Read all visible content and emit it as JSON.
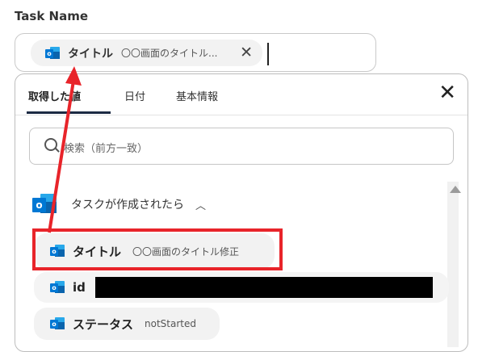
{
  "field": {
    "label": "Task Name",
    "chip": {
      "name": "タイトル",
      "value": "〇〇画面のタイトル...",
      "icon": "outlook-icon",
      "remove_icon": "close-icon"
    }
  },
  "panel": {
    "tabs": [
      {
        "label": "取得した値",
        "active": true
      },
      {
        "label": "日付",
        "active": false
      },
      {
        "label": "基本情報",
        "active": false
      }
    ],
    "close_icon": "close-icon",
    "search": {
      "placeholder": "検索（前方一致）",
      "icon": "search-icon"
    },
    "group": {
      "label": "タスクが作成されたら",
      "icon": "outlook-icon",
      "toggle_icon": "chevron-up-icon"
    },
    "items": [
      {
        "name": "タイトル",
        "value": "〇〇画面のタイトル修正",
        "highlighted": true
      },
      {
        "name": "id",
        "value": "",
        "redacted": true
      },
      {
        "name": "ステータス",
        "value": "notStarted"
      }
    ]
  },
  "colors": {
    "annotation": "#e8242a",
    "outlook_blue": "#0078d4",
    "tab_underline": "#1b2a44"
  }
}
